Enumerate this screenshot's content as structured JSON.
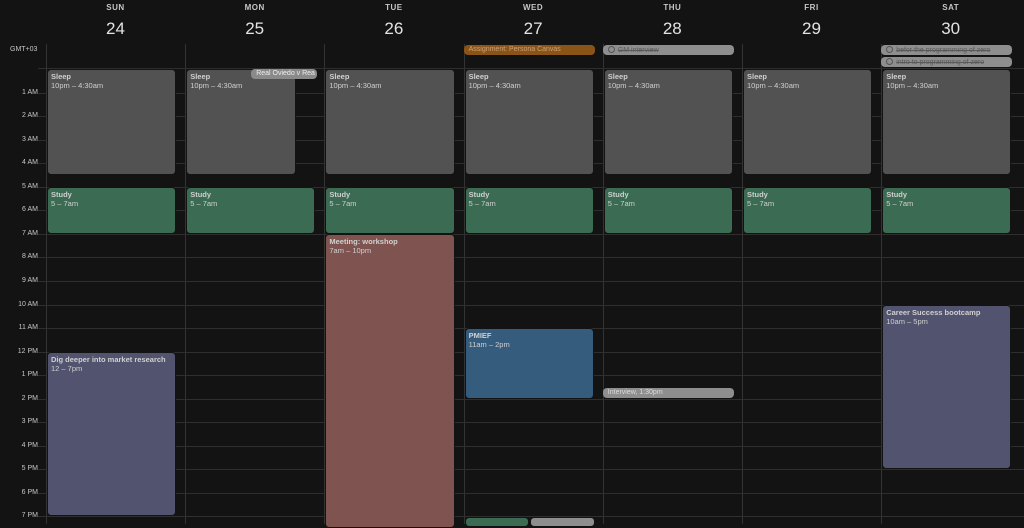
{
  "timezone": "GMT+03",
  "days": [
    {
      "dow": "SUN",
      "num": "24"
    },
    {
      "dow": "MON",
      "num": "25"
    },
    {
      "dow": "TUE",
      "num": "26"
    },
    {
      "dow": "WED",
      "num": "27"
    },
    {
      "dow": "THU",
      "num": "28"
    },
    {
      "dow": "FRI",
      "num": "29"
    },
    {
      "dow": "SAT",
      "num": "30"
    }
  ],
  "hours": [
    "1 AM",
    "2 AM",
    "3 AM",
    "4 AM",
    "5 AM",
    "6 AM",
    "7 AM",
    "8 AM",
    "9 AM",
    "10 AM",
    "11 AM",
    "12 PM",
    "1 PM",
    "2 PM",
    "3 PM",
    "4 PM",
    "5 PM",
    "6 PM",
    "7 PM"
  ],
  "allday": {
    "wed": "Assignment: Persona Canvas",
    "thu": "GM interview",
    "sat1": "befor the programming of zero",
    "sat2": "intro to programming of zero"
  },
  "sleep": {
    "title": "Sleep",
    "time": "10pm – 4:30am"
  },
  "study": {
    "title": "Study",
    "time": "5 – 7am"
  },
  "mon_chip": "Real Oviedo v Rea",
  "meeting": {
    "title": "Meeting: workshop",
    "time": "7am – 10pm"
  },
  "research": {
    "title": "Dig deeper into market research",
    "time": "12 – 7pm"
  },
  "pmief": {
    "title": "PMIEF",
    "time": "11am – 2pm"
  },
  "interview": "Interview, 1:30pm",
  "career": {
    "title": "Career Success bootcamp",
    "time": "10am – 5pm"
  },
  "colors": {
    "sleep": "#525252",
    "study": "#3b6b52",
    "meeting": "#7f5450",
    "research": "#52536f",
    "pmief": "#355c7d",
    "assignment": "#8a5417",
    "chip": "#8e8e8e"
  }
}
